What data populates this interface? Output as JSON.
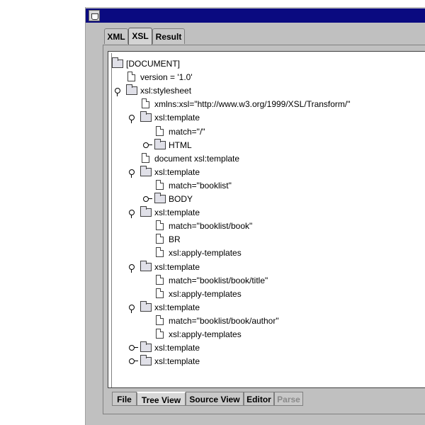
{
  "window": {
    "title": "",
    "titlebar_color": "#0a0a80"
  },
  "top_tabs": [
    "XML",
    "XSL",
    "Result"
  ],
  "active_top_tab": "XSL",
  "tree": [
    {
      "label": "[DOCUMENT]",
      "type": "folder",
      "depth": 0,
      "handle": "none"
    },
    {
      "label": "version = '1.0'",
      "type": "file",
      "depth": 1,
      "handle": "none"
    },
    {
      "label": "xsl:stylesheet",
      "type": "folder",
      "depth": 1,
      "handle": "expanded"
    },
    {
      "label": "xmlns:xsl=\"http://www.w3.org/1999/XSL/Transform/\"",
      "type": "file",
      "depth": 2,
      "handle": "none"
    },
    {
      "label": "xsl:template",
      "type": "folder",
      "depth": 2,
      "handle": "expanded"
    },
    {
      "label": "match=\"/\"",
      "type": "file",
      "depth": 3,
      "handle": "none"
    },
    {
      "label": "HTML",
      "type": "folder",
      "depth": 3,
      "handle": "collapsed"
    },
    {
      "label": "document xsl:template",
      "type": "file",
      "depth": 2,
      "handle": "none"
    },
    {
      "label": "xsl:template",
      "type": "folder",
      "depth": 2,
      "handle": "expanded"
    },
    {
      "label": "match=\"booklist\"",
      "type": "file",
      "depth": 3,
      "handle": "none"
    },
    {
      "label": "BODY",
      "type": "folder",
      "depth": 3,
      "handle": "collapsed"
    },
    {
      "label": "xsl:template",
      "type": "folder",
      "depth": 2,
      "handle": "expanded"
    },
    {
      "label": "match=\"booklist/book\"",
      "type": "file",
      "depth": 3,
      "handle": "none"
    },
    {
      "label": "BR",
      "type": "file",
      "depth": 3,
      "handle": "none"
    },
    {
      "label": "xsl:apply-templates",
      "type": "file",
      "depth": 3,
      "handle": "none"
    },
    {
      "label": "xsl:template",
      "type": "folder",
      "depth": 2,
      "handle": "expanded"
    },
    {
      "label": "match=\"booklist/book/title\"",
      "type": "file",
      "depth": 3,
      "handle": "none"
    },
    {
      "label": "xsl:apply-templates",
      "type": "file",
      "depth": 3,
      "handle": "none"
    },
    {
      "label": "xsl:template",
      "type": "folder",
      "depth": 2,
      "handle": "expanded"
    },
    {
      "label": "match=\"booklist/book/author\"",
      "type": "file",
      "depth": 3,
      "handle": "none"
    },
    {
      "label": "xsl:apply-templates",
      "type": "file",
      "depth": 3,
      "handle": "none"
    },
    {
      "label": "xsl:template",
      "type": "folder",
      "depth": 2,
      "handle": "collapsed"
    },
    {
      "label": "xsl:template",
      "type": "folder",
      "depth": 2,
      "handle": "collapsed"
    }
  ],
  "bottom_tabs": [
    {
      "label": "File",
      "state": "normal"
    },
    {
      "label": "Tree View",
      "state": "active"
    },
    {
      "label": "Source View",
      "state": "normal"
    },
    {
      "label": "Editor",
      "state": "normal"
    },
    {
      "label": "Parse",
      "state": "disabled"
    }
  ]
}
